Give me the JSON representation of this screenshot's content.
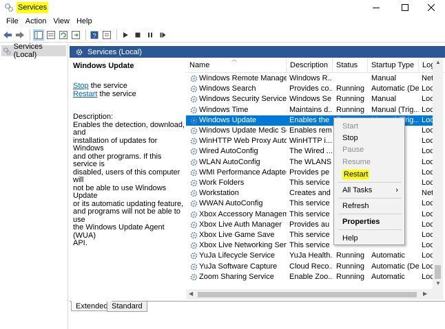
{
  "window": {
    "title": "Services"
  },
  "menubar": {
    "items": [
      "File",
      "Action",
      "View",
      "Help"
    ]
  },
  "tree": {
    "item": "Services (Local)"
  },
  "panel": {
    "header": "Services (Local)"
  },
  "description": {
    "service_name": "Windows Update",
    "stop_link": "Stop",
    "stop_suffix": " the service",
    "restart_link": "Restart",
    "restart_suffix": " the service",
    "label": "Description:",
    "body_lines": [
      "Enables the detection, download, and",
      "installation of updates for Windows",
      "and other programs. If this service is",
      "disabled, users of this computer will",
      "not be able to use Windows Update",
      "or its automatic updating feature,",
      "and programs will not be able to use",
      "the Windows Update Agent (WUA)",
      "API."
    ]
  },
  "table": {
    "columns": [
      "Name",
      "Description",
      "Status",
      "Startup Type",
      "Log"
    ],
    "rows": [
      {
        "name": "Windows Remote Manage...",
        "description": "Windows R...",
        "status": "",
        "startup": "Manual",
        "log": "Net"
      },
      {
        "name": "Windows Search",
        "description": "Provides co...",
        "status": "Running",
        "startup": "Automatic (De...",
        "log": "Loc"
      },
      {
        "name": "Windows Security Service",
        "description": "Windows Se...",
        "status": "Running",
        "startup": "Manual",
        "log": "Loc"
      },
      {
        "name": "Windows Time",
        "description": "Maintains d...",
        "status": "Running",
        "startup": "Manual (Trig...",
        "log": "Loc"
      },
      {
        "name": "Windows Update",
        "description": "Enables the",
        "status": "",
        "startup": "",
        "log": "Loc"
      },
      {
        "name": "Windows Update Medic Ser...",
        "description": "Enables rem",
        "status": "",
        "startup": "",
        "log": "Loc"
      },
      {
        "name": "WinHTTP Web Proxy Auto-...",
        "description": "WinHTTP i...",
        "status": "",
        "startup": "",
        "log": "Loc"
      },
      {
        "name": "Wired AutoConfig",
        "description": "The Wired ...",
        "status": "",
        "startup": "",
        "log": "Loc"
      },
      {
        "name": "WLAN AutoConfig",
        "description": "The WLANS",
        "status": "",
        "startup": "",
        "log": "Loc"
      },
      {
        "name": "WMI Performance Adapter",
        "description": "Provides pe",
        "status": "",
        "startup": "",
        "log": "Loc"
      },
      {
        "name": "Work Folders",
        "description": "This service",
        "status": "",
        "startup": "",
        "log": "Loc"
      },
      {
        "name": "Workstation",
        "description": "Creates and",
        "status": "",
        "startup": "",
        "log": "Net"
      },
      {
        "name": "WWAN AutoConfig",
        "description": "This service",
        "status": "",
        "startup": "",
        "log": "Loc"
      },
      {
        "name": "Xbox Accessory Manageme...",
        "description": "This service",
        "status": "",
        "startup": "",
        "log": "Loc"
      },
      {
        "name": "Xbox Live Auth Manager",
        "description": "Provides au",
        "status": "",
        "startup": "",
        "log": "Loc"
      },
      {
        "name": "Xbox Live Game Save",
        "description": "This service",
        "status": "",
        "startup": "",
        "log": "Loc"
      },
      {
        "name": "Xbox Live Networking Service",
        "description": "This service",
        "status": "",
        "startup": "",
        "log": "Loc"
      },
      {
        "name": "YuJa Lifecycle Service",
        "description": "YuJa Health...",
        "status": "Running",
        "startup": "Automatic",
        "log": "Loc"
      },
      {
        "name": "YuJa Software Capture",
        "description": "Cloud Reco...",
        "status": "Running",
        "startup": "Automatic (De...",
        "log": "Loc"
      },
      {
        "name": "Zoom Sharing Service",
        "description": "Enable Zoo...",
        "status": "Running",
        "startup": "Automatic",
        "log": "Loc"
      }
    ],
    "selected_index": 4,
    "selected_partial": {
      "status": "R",
      "startup": "Manual (Trig..."
    }
  },
  "context_menu": {
    "start": "Start",
    "stop": "Stop",
    "pause": "Pause",
    "resume": "Resume",
    "restart": "Restart",
    "all_tasks": "All Tasks",
    "refresh": "Refresh",
    "properties": "Properties",
    "help": "Help"
  },
  "tabs": [
    "Extended",
    "Standard"
  ],
  "colors": {
    "header_blue": "#2b5797",
    "selection_blue": "#0078d7",
    "highlight_yellow": "#ffff00"
  }
}
